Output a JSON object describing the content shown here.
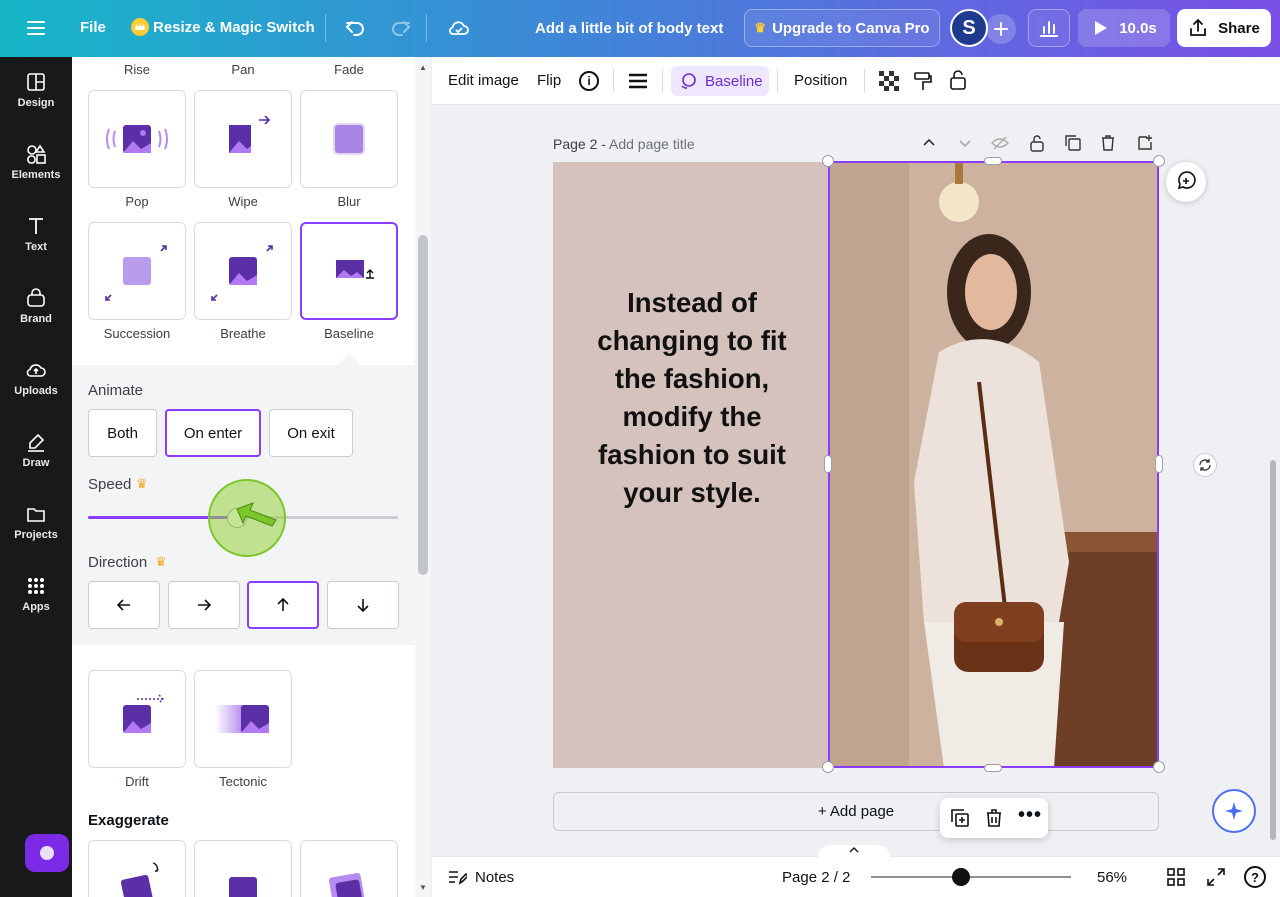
{
  "topbar": {
    "menu_icon": "hamburger-icon",
    "file_label": "File",
    "resize_label": "Resize & Magic Switch",
    "document_title": "Add a little bit of body text",
    "upgrade_label": "Upgrade to Canva Pro",
    "avatar_initial": "S",
    "play_label": "10.0s",
    "share_label": "Share"
  },
  "rail": {
    "items": [
      {
        "label": "Design",
        "icon": "design-icon"
      },
      {
        "label": "Elements",
        "icon": "elements-icon"
      },
      {
        "label": "Text",
        "icon": "text-icon"
      },
      {
        "label": "Brand",
        "icon": "brand-icon"
      },
      {
        "label": "Uploads",
        "icon": "uploads-icon"
      },
      {
        "label": "Draw",
        "icon": "draw-icon"
      },
      {
        "label": "Projects",
        "icon": "folder-icon"
      },
      {
        "label": "Apps",
        "icon": "apps-icon"
      }
    ]
  },
  "panel": {
    "top_labels": [
      "Rise",
      "Pan",
      "Fade"
    ],
    "row1": [
      "Pop",
      "Wipe",
      "Blur"
    ],
    "row2": [
      "Succession",
      "Breathe",
      "Baseline"
    ],
    "animate_title": "Animate",
    "animate_options": [
      "Both",
      "On enter",
      "On exit"
    ],
    "speed_title": "Speed",
    "speed_level": 0.48,
    "direction_title": "Direction",
    "row3": [
      "Drift",
      "Tectonic"
    ],
    "exaggerate_title": "Exaggerate"
  },
  "toolbar": {
    "edit_image": "Edit image",
    "flip": "Flip",
    "baseline": "Baseline",
    "position": "Position"
  },
  "canvas": {
    "page_label": "Page 2 -",
    "page_title_placeholder": "Add page title",
    "quote": "Instead of changing to fit the fashion, modify the fashion to suit your style.",
    "add_page": "+ Add page"
  },
  "status": {
    "notes": "Notes",
    "page_indicator": "Page 2 / 2",
    "zoom": "56%",
    "zoom_level": 0.45
  },
  "colors": {
    "accent": "#8b3dff",
    "page_bg": "#d6c2bc"
  }
}
